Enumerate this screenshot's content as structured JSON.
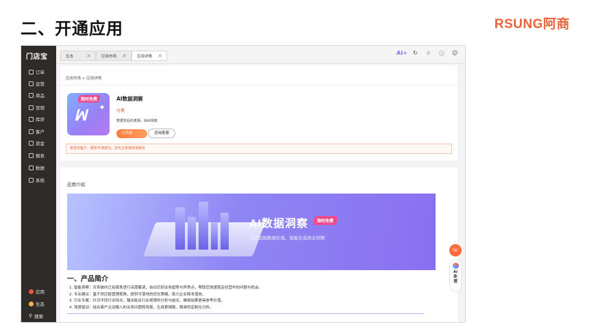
{
  "slide": {
    "title": "二、开通应用",
    "brand": "RSUNG阿商"
  },
  "sidebar": {
    "logo": "门店宝",
    "items": [
      {
        "label": "订单",
        "icon": "order-icon"
      },
      {
        "label": "运营",
        "icon": "operation-icon"
      },
      {
        "label": "商品",
        "icon": "goods-icon"
      },
      {
        "label": "营销",
        "icon": "marketing-icon"
      },
      {
        "label": "库存",
        "icon": "inventory-icon"
      },
      {
        "label": "客户",
        "icon": "customer-icon"
      },
      {
        "label": "资金",
        "icon": "funds-icon"
      },
      {
        "label": "报表",
        "icon": "report-icon"
      },
      {
        "label": "数据",
        "icon": "data-icon"
      },
      {
        "label": "系统",
        "icon": "system-icon"
      }
    ],
    "bottom": [
      {
        "label": "应用",
        "icon": "apps-icon",
        "color": "#f0543a"
      },
      {
        "label": "生态",
        "icon": "ecosystem-icon",
        "color": "#f5b83a"
      },
      {
        "label": "搜索",
        "icon": "search-icon",
        "color": "#e6e6e6"
      }
    ]
  },
  "tabs": [
    {
      "label": "生态"
    },
    {
      "label": "应用市场"
    },
    {
      "label": "应用详情"
    }
  ],
  "toolbar": {
    "ai_label": "AI+"
  },
  "detail": {
    "breadcrumb": "应用市场 > 应用详情",
    "badge": "限时免费",
    "app_name": "AI数据洞察",
    "price": "付费",
    "description": "数据背后的真相，由AI揭晓",
    "open_button": "已开启",
    "consult_button": "咨询客服",
    "notice": "亲爱的客户，服务开通成功，您可正常使用该服务"
  },
  "intro": {
    "heading": "应用介绍",
    "banner_title": "AI数据洞察",
    "banner_badge": "限时免费",
    "banner_subtitle": "深度挖掘数据价值，智能生成商业洞察",
    "section_title": "一、产品简介",
    "features": [
      "1.  智能洞察：对系统内已有报表进行深度解读，自动识别业务趋势与异常点，帮助您快速锁定经营中的问题与机会。",
      "2.  专业建议：基于供应链管理视角，提供可落地的优化策略，助力企业降本增效。",
      "3.  行业专属：针对不同行业特点，输出贴合行业规律的分析与结论，确保结果更具参考价值。",
      "4.  场景驱动：结合客户主动输入的业务问题和场景，生成更细致、精准的定制化分析。"
    ]
  },
  "float": {
    "assistant_lines": [
      "AI",
      "助",
      "理"
    ]
  },
  "colors": {
    "accent": "#e8643a",
    "sidebar_bg": "#2e2b29",
    "banner": "#8a6ff0",
    "badge": "#f04a8b"
  }
}
